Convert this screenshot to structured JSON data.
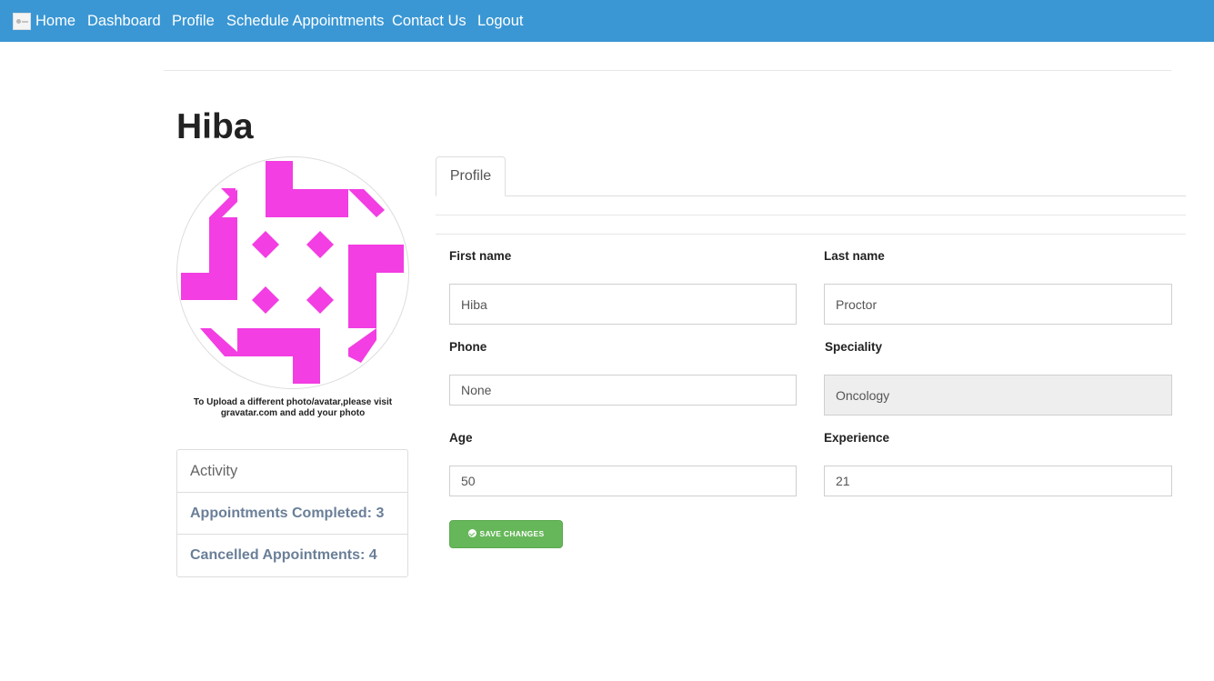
{
  "nav": {
    "items": [
      {
        "label": "Home"
      },
      {
        "label": "Dashboard"
      },
      {
        "label": "Profile"
      },
      {
        "label": "Schedule Appointments"
      },
      {
        "label": "Contact Us"
      },
      {
        "label": "Logout"
      }
    ],
    "background_color": "#3a97d4"
  },
  "profile": {
    "name": "Hiba",
    "avatar_color": "#f23ee2",
    "avatar_note": "To Upload a different photo/avatar,please visit gravatar.com and add your photo"
  },
  "activity": {
    "heading": "Activity",
    "items": [
      {
        "text": "Appointments Completed: 3"
      },
      {
        "text": "Cancelled Appointments: 4"
      }
    ]
  },
  "tabs": [
    {
      "label": "Profile",
      "active": true
    }
  ],
  "form": {
    "first_name": {
      "label": "First name",
      "value": "Hiba"
    },
    "last_name": {
      "label": "Last name",
      "value": "Proctor"
    },
    "phone": {
      "label": "Phone",
      "value": "None"
    },
    "speciality": {
      "label": "Speciality",
      "value": "Oncology",
      "readonly": true
    },
    "age": {
      "label": "Age",
      "value": "50"
    },
    "experience": {
      "label": "Experience",
      "value": "21"
    },
    "save_label": "SAVE CHANGES",
    "save_color": "#66b75a"
  }
}
